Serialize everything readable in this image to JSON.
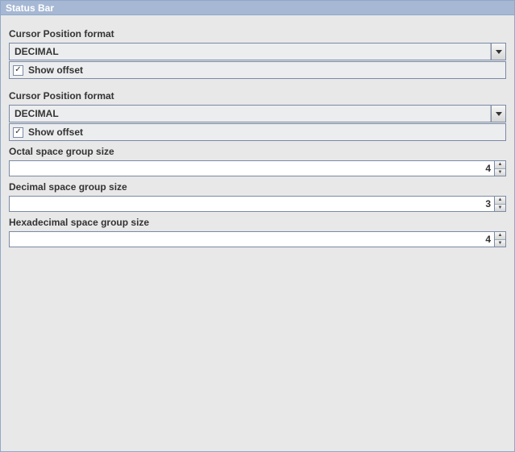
{
  "window": {
    "title": "Status Bar"
  },
  "section1": {
    "label": "Cursor Position format",
    "combo_value": "DECIMAL",
    "show_offset_label": "Show offset",
    "show_offset_checked": true
  },
  "section2": {
    "label": "Cursor Position format",
    "combo_value": "DECIMAL",
    "show_offset_label": "Show offset",
    "show_offset_checked": true
  },
  "octal": {
    "label": "Octal space group size",
    "value": "4"
  },
  "decimal": {
    "label": "Decimal space group size",
    "value": "3"
  },
  "hex": {
    "label": "Hexadecimal space group size",
    "value": "4"
  }
}
